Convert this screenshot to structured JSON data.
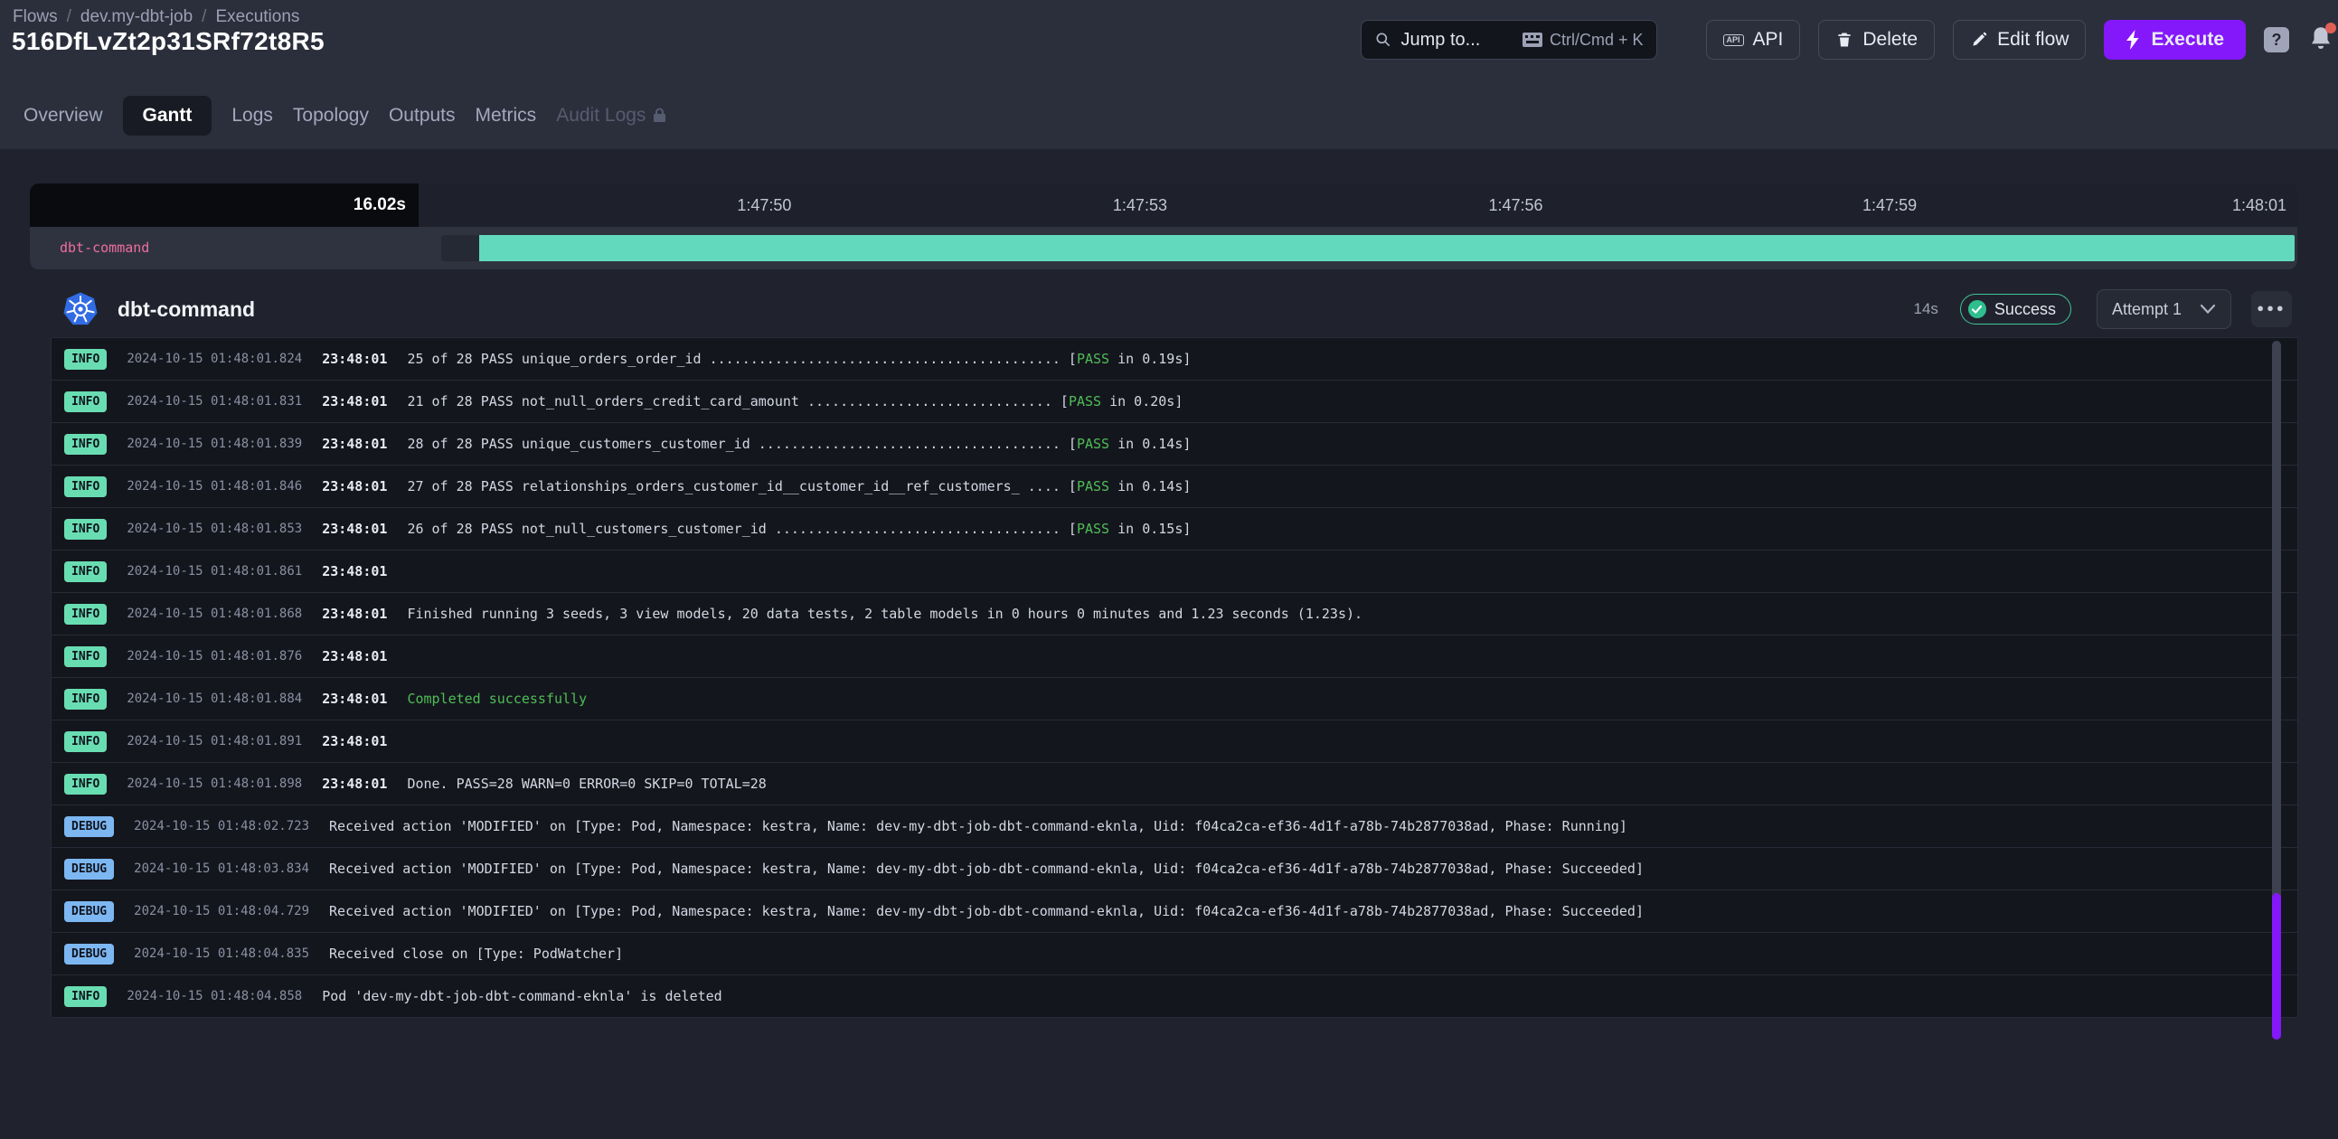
{
  "header": {
    "breadcrumb": [
      "Flows",
      "dev.my-dbt-job",
      "Executions"
    ],
    "title": "516DfLvZt2p31SRf72t8R5",
    "search": {
      "placeholder": "Jump to...",
      "shortcut": "Ctrl/Cmd + K"
    },
    "api_label": "API",
    "delete_label": "Delete",
    "edit_label": "Edit flow",
    "execute_label": "Execute",
    "help_label": "?"
  },
  "tabs": [
    {
      "label": "Overview",
      "state": "normal"
    },
    {
      "label": "Gantt",
      "state": "active"
    },
    {
      "label": "Logs",
      "state": "normal"
    },
    {
      "label": "Topology",
      "state": "normal"
    },
    {
      "label": "Outputs",
      "state": "normal"
    },
    {
      "label": "Metrics",
      "state": "normal"
    },
    {
      "label": "Audit Logs",
      "state": "locked"
    }
  ],
  "gantt": {
    "duration": "16.02s",
    "ticks": [
      "1:47:50",
      "1:47:53",
      "1:47:56",
      "1:47:59",
      "1:48:01"
    ],
    "task_label": "dbt-command"
  },
  "task": {
    "name": "dbt-command",
    "icon": "kubernetes-icon",
    "duration": "14s",
    "status": "Success",
    "attempt": "Attempt 1",
    "more": "●●●"
  },
  "logs": [
    {
      "level": "INFO",
      "ts": "2024-10-15 01:48:01.824",
      "time": "23:48:01",
      "parts": [
        {
          "t": "25 of 28 PASS unique_orders_order_id ........................................... [",
          "c": "d"
        },
        {
          "t": "PASS",
          "c": "g"
        },
        {
          "t": " in 0.19s]",
          "c": "d"
        }
      ]
    },
    {
      "level": "INFO",
      "ts": "2024-10-15 01:48:01.831",
      "time": "23:48:01",
      "parts": [
        {
          "t": "21 of 28 PASS not_null_orders_credit_card_amount .............................. [",
          "c": "d"
        },
        {
          "t": "PASS",
          "c": "g"
        },
        {
          "t": " in 0.20s]",
          "c": "d"
        }
      ]
    },
    {
      "level": "INFO",
      "ts": "2024-10-15 01:48:01.839",
      "time": "23:48:01",
      "parts": [
        {
          "t": "28 of 28 PASS unique_customers_customer_id ..................................... [",
          "c": "d"
        },
        {
          "t": "PASS",
          "c": "g"
        },
        {
          "t": " in 0.14s]",
          "c": "d"
        }
      ]
    },
    {
      "level": "INFO",
      "ts": "2024-10-15 01:48:01.846",
      "time": "23:48:01",
      "parts": [
        {
          "t": "27 of 28 PASS relationships_orders_customer_id__customer_id__ref_customers_ .... [",
          "c": "d"
        },
        {
          "t": "PASS",
          "c": "g"
        },
        {
          "t": " in 0.14s]",
          "c": "d"
        }
      ]
    },
    {
      "level": "INFO",
      "ts": "2024-10-15 01:48:01.853",
      "time": "23:48:01",
      "parts": [
        {
          "t": "26 of 28 PASS not_null_customers_customer_id ................................... [",
          "c": "d"
        },
        {
          "t": "PASS",
          "c": "g"
        },
        {
          "t": " in 0.15s]",
          "c": "d"
        }
      ]
    },
    {
      "level": "INFO",
      "ts": "2024-10-15 01:48:01.861",
      "time": "23:48:01",
      "parts": []
    },
    {
      "level": "INFO",
      "ts": "2024-10-15 01:48:01.868",
      "time": "23:48:01",
      "parts": [
        {
          "t": "Finished running 3 seeds, 3 view models, 20 data tests, 2 table models in 0 hours 0 minutes and 1.23 seconds (1.23s).",
          "c": "d"
        }
      ]
    },
    {
      "level": "INFO",
      "ts": "2024-10-15 01:48:01.876",
      "time": "23:48:01",
      "parts": []
    },
    {
      "level": "INFO",
      "ts": "2024-10-15 01:48:01.884",
      "time": "23:48:01",
      "parts": [
        {
          "t": "Completed successfully",
          "c": "g"
        }
      ]
    },
    {
      "level": "INFO",
      "ts": "2024-10-15 01:48:01.891",
      "time": "23:48:01",
      "parts": []
    },
    {
      "level": "INFO",
      "ts": "2024-10-15 01:48:01.898",
      "time": "23:48:01",
      "parts": [
        {
          "t": "Done. PASS=28 WARN=0 ERROR=0 SKIP=0 TOTAL=28",
          "c": "d"
        }
      ]
    },
    {
      "level": "DEBUG",
      "ts": "2024-10-15 01:48:02.723",
      "time": "",
      "parts": [
        {
          "t": "Received action 'MODIFIED' on [Type: Pod, Namespace: kestra, Name: dev-my-dbt-job-dbt-command-eknla, Uid: f04ca2ca-ef36-4d1f-a78b-74b2877038ad, Phase: Running]",
          "c": "d"
        }
      ]
    },
    {
      "level": "DEBUG",
      "ts": "2024-10-15 01:48:03.834",
      "time": "",
      "parts": [
        {
          "t": "Received action 'MODIFIED' on [Type: Pod, Namespace: kestra, Name: dev-my-dbt-job-dbt-command-eknla, Uid: f04ca2ca-ef36-4d1f-a78b-74b2877038ad, Phase: Succeeded]",
          "c": "d"
        }
      ]
    },
    {
      "level": "DEBUG",
      "ts": "2024-10-15 01:48:04.729",
      "time": "",
      "parts": [
        {
          "t": "Received action 'MODIFIED' on [Type: Pod, Namespace: kestra, Name: dev-my-dbt-job-dbt-command-eknla, Uid: f04ca2ca-ef36-4d1f-a78b-74b2877038ad, Phase: Succeeded]",
          "c": "d"
        }
      ]
    },
    {
      "level": "DEBUG",
      "ts": "2024-10-15 01:48:04.835",
      "time": "",
      "parts": [
        {
          "t": "Received close on [Type: PodWatcher]",
          "c": "d"
        }
      ]
    },
    {
      "level": "INFO",
      "ts": "2024-10-15 01:48:04.858",
      "time": "",
      "parts": [
        {
          "t": "Pod 'dev-my-dbt-job-dbt-command-eknla' is deleted",
          "c": "d"
        }
      ]
    }
  ],
  "colors": {
    "accent_purple": "#8418FB",
    "bar_teal": "#62D9BD",
    "info_badge": "#69DDB2",
    "debug_badge": "#7DB7F2",
    "success_green": "#4FBD57",
    "task_label_pink": "#EF6E9F"
  }
}
